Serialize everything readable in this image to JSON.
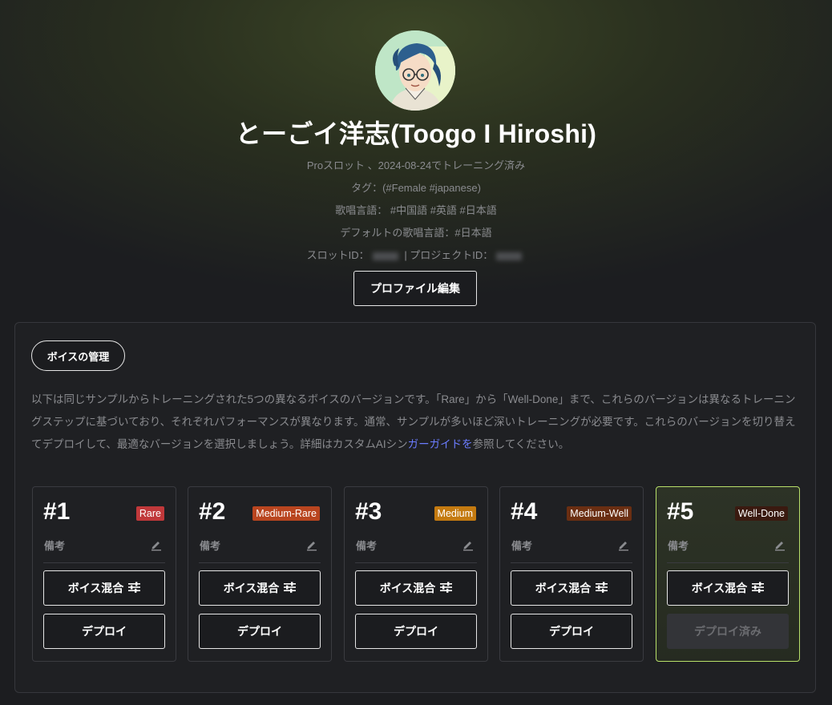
{
  "profile": {
    "name": "とーごイ洋志(Toogo I Hiroshi)",
    "slot_info": "Proスロット 、2024-08-24でトレーニング済み",
    "tags": "タグ：(#Female #japanese)",
    "languages": "歌唱言語： #中国語 #英語 #日本語",
    "default_language": "デフォルトの歌唱言語：#日本語",
    "slot_id_label": "スロットID：",
    "project_id_label": "| プロジェクトID：",
    "edit_button": "プロファイル編集"
  },
  "voice_management": {
    "title": "ボイスの管理",
    "description_before_link": "以下は同じサンプルからトレーニングされた5つの異なるボイスのバージョンです。「Rare」から「Well-Done」まで、これらのバージョンは異なるトレーニングステップに基づいており、それぞれパフォーマンスが異なります。通常、サンプルが多いほど深いトレーニングが必要です。これらのバージョンを切り替えてデプロイして、最適なバージョンを選択しましょう。詳細はカスタムAIシン",
    "link_text": "ガーガイドを",
    "description_after_link": "参照してください。",
    "cards": [
      {
        "num": "#1",
        "badge": "Rare",
        "badge_color": "#c0383a",
        "note": "備考",
        "mix": "ボイス混合",
        "deploy": "デプロイ",
        "active": false
      },
      {
        "num": "#2",
        "badge": "Medium-Rare",
        "badge_color": "#b9451f",
        "note": "備考",
        "mix": "ボイス混合",
        "deploy": "デプロイ",
        "active": false
      },
      {
        "num": "#3",
        "badge": "Medium",
        "badge_color": "#c47a10",
        "note": "備考",
        "mix": "ボイス混合",
        "deploy": "デプロイ",
        "active": false
      },
      {
        "num": "#4",
        "badge": "Medium-Well",
        "badge_color": "#6a2e12",
        "note": "備考",
        "mix": "ボイス混合",
        "deploy": "デプロイ",
        "active": false
      },
      {
        "num": "#5",
        "badge": "Well-Done",
        "badge_color": "#3a1a10",
        "note": "備考",
        "mix": "ボイス混合",
        "deploy": "デプロイ済み",
        "active": true
      }
    ]
  },
  "colors": {
    "accent_link": "#6b7cff",
    "active_border": "#b8e06a"
  }
}
